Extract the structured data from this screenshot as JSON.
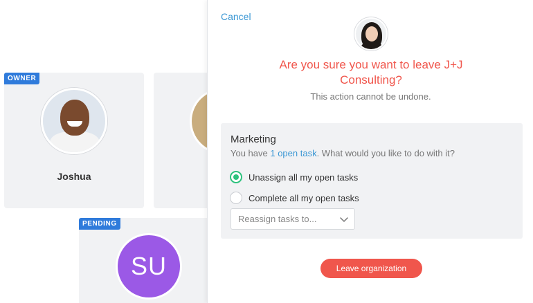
{
  "background": {
    "owner_card": {
      "badge": "OWNER",
      "name": "Joshua"
    },
    "pending_card": {
      "badge": "PENDING",
      "initials": "SU",
      "avatar_color": "#9b59e6"
    }
  },
  "modal": {
    "cancel_label": "Cancel",
    "title": "Are you sure you want to leave J+J Consulting?",
    "subtitle": "This action cannot be undone.",
    "section": {
      "title": "Marketing",
      "desc_prefix": "You have ",
      "desc_link": "1 open task",
      "desc_suffix": ". What would you like to do with it?",
      "options": [
        {
          "label": "Unassign all my open tasks",
          "checked": true
        },
        {
          "label": "Complete all my open tasks",
          "checked": false
        }
      ],
      "reassign_placeholder": "Reassign tasks to..."
    },
    "leave_button": "Leave organization"
  },
  "colors": {
    "accent_red": "#f0564c",
    "link_blue": "#3a97d4",
    "badge_blue": "#2f7bdb",
    "radio_green": "#2ec27e"
  }
}
